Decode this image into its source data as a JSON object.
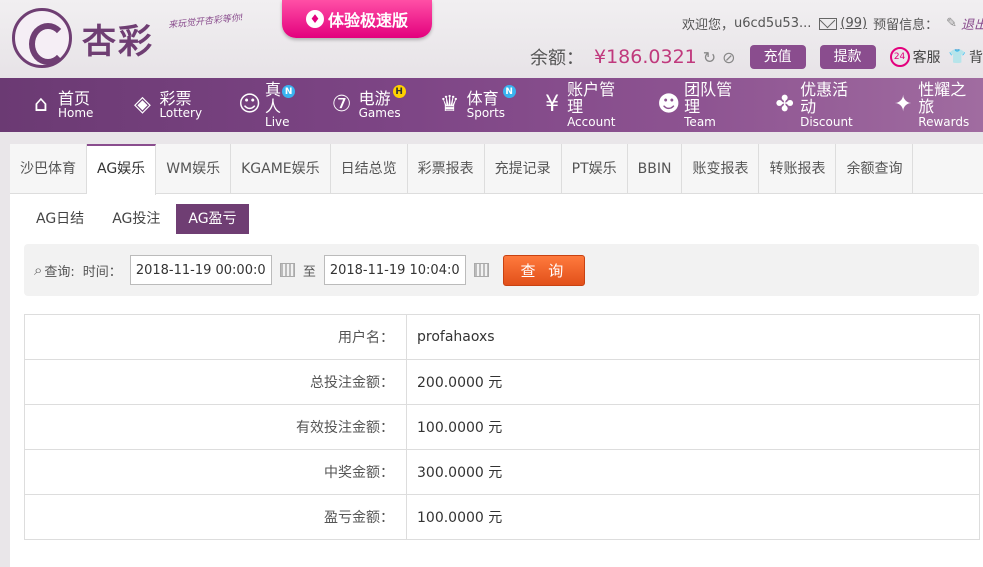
{
  "header": {
    "logo_text": "杏彩",
    "slogan": "来玩觉开杏彩等你!",
    "promo": "体验极速版",
    "welcome": "欢迎您，",
    "username_short": "u6cd5u53...",
    "message_count": "(99)",
    "reserve_info": "预留信息：",
    "logout": "退出",
    "balance_label": "余额：",
    "balance_value": "¥186.0321",
    "deposit": "充值",
    "withdraw": "提款",
    "service": "客服",
    "background": "背景"
  },
  "nav": [
    {
      "cn": "首页",
      "en": "Home",
      "icon": "home-icon"
    },
    {
      "cn": "彩票",
      "en": "Lottery",
      "icon": "ticket-icon"
    },
    {
      "cn": "真人",
      "en": "Live",
      "icon": "person-icon",
      "badge": "N"
    },
    {
      "cn": "电游",
      "en": "Games",
      "icon": "seven-icon",
      "badge": "H"
    },
    {
      "cn": "体育",
      "en": "Sports",
      "icon": "trophy-icon",
      "badge": "N"
    },
    {
      "cn": "账户管理",
      "en": "Account",
      "icon": "yen-icon"
    },
    {
      "cn": "团队管理",
      "en": "Team",
      "icon": "team-icon"
    },
    {
      "cn": "优惠活动",
      "en": "Discount",
      "icon": "gift-icon"
    },
    {
      "cn": "性耀之旅",
      "en": "Rewards",
      "icon": "rewards-icon"
    }
  ],
  "tabs": [
    "沙巴体育",
    "AG娱乐",
    "WM娱乐",
    "KGAME娱乐",
    "日结总览",
    "彩票报表",
    "充提记录",
    "PT娱乐",
    "BBIN",
    "账变报表",
    "转账报表",
    "余额查询"
  ],
  "active_tab": "AG娱乐",
  "subtabs": [
    "AG日结",
    "AG投注",
    "AG盈亏"
  ],
  "active_subtab": "AG盈亏",
  "query": {
    "search_label": "查询:",
    "time_label": "时间：",
    "start": "2018-11-19 00:00:00",
    "to_label": "至",
    "end": "2018-11-19 10:04:03",
    "button": "查 询"
  },
  "results": [
    {
      "label": "用户名：",
      "value": "profahaoxs"
    },
    {
      "label": "总投注金额：",
      "value": "200.0000 元"
    },
    {
      "label": "有效投注金额：",
      "value": "100.0000 元"
    },
    {
      "label": "中奖金额：",
      "value": "300.0000 元"
    },
    {
      "label": "盈亏金额：",
      "value": "100.0000 元"
    }
  ]
}
